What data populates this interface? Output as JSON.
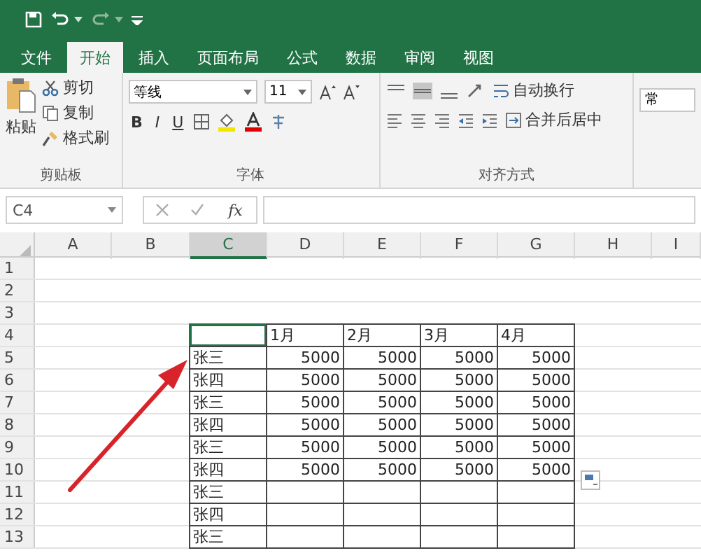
{
  "tabs": [
    {
      "label": "文件",
      "selected": false
    },
    {
      "label": "开始",
      "selected": true
    },
    {
      "label": "插入",
      "selected": false
    },
    {
      "label": "页面布局",
      "selected": false
    },
    {
      "label": "公式",
      "selected": false
    },
    {
      "label": "数据",
      "selected": false
    },
    {
      "label": "审阅",
      "selected": false
    },
    {
      "label": "视图",
      "selected": false
    }
  ],
  "ribbon": {
    "clipboard": {
      "paste": "粘贴",
      "cut": "剪切",
      "copy": "复制",
      "format_painter": "格式刷",
      "title": "剪贴板"
    },
    "font": {
      "name": "等线",
      "size": "11",
      "bold": "B",
      "italic": "I",
      "underline": "U",
      "title": "字体"
    },
    "alignment": {
      "wrap_text": "自动换行",
      "merge_center": "合并后居中",
      "title": "对齐方式"
    },
    "number": {
      "format": "常"
    }
  },
  "formula_bar": {
    "name_box": "C4",
    "function_label": "fx"
  },
  "columns": [
    {
      "label": "A",
      "selected": false
    },
    {
      "label": "B",
      "selected": false
    },
    {
      "label": "C",
      "selected": true
    },
    {
      "label": "D",
      "selected": false
    },
    {
      "label": "E",
      "selected": false
    },
    {
      "label": "F",
      "selected": false
    },
    {
      "label": "G",
      "selected": false
    },
    {
      "label": "H",
      "selected": false
    },
    {
      "label": "I",
      "selected": false
    }
  ],
  "rows": [
    {
      "label": "1"
    },
    {
      "label": "2"
    },
    {
      "label": "3"
    },
    {
      "label": "4"
    },
    {
      "label": "5"
    },
    {
      "label": "6"
    },
    {
      "label": "7"
    },
    {
      "label": "8"
    },
    {
      "label": "9"
    },
    {
      "label": "10"
    },
    {
      "label": "11"
    },
    {
      "label": "12"
    },
    {
      "label": "13"
    }
  ],
  "table": {
    "corner": {
      "selected": true
    },
    "headers": [
      "1月",
      "2月",
      "3月",
      "4月"
    ],
    "rows": [
      {
        "name": "张三",
        "values": [
          "5000",
          "5000",
          "5000",
          "5000"
        ]
      },
      {
        "name": "张四",
        "values": [
          "5000",
          "5000",
          "5000",
          "5000"
        ]
      },
      {
        "name": "张三",
        "values": [
          "5000",
          "5000",
          "5000",
          "5000"
        ]
      },
      {
        "name": "张四",
        "values": [
          "5000",
          "5000",
          "5000",
          "5000"
        ]
      },
      {
        "name": "张三",
        "values": [
          "5000",
          "5000",
          "5000",
          "5000"
        ]
      },
      {
        "name": "张四",
        "values": [
          "5000",
          "5000",
          "5000",
          "5000"
        ]
      },
      {
        "name": "张三"
      },
      {
        "name": "张四"
      },
      {
        "name": "张三"
      }
    ]
  }
}
